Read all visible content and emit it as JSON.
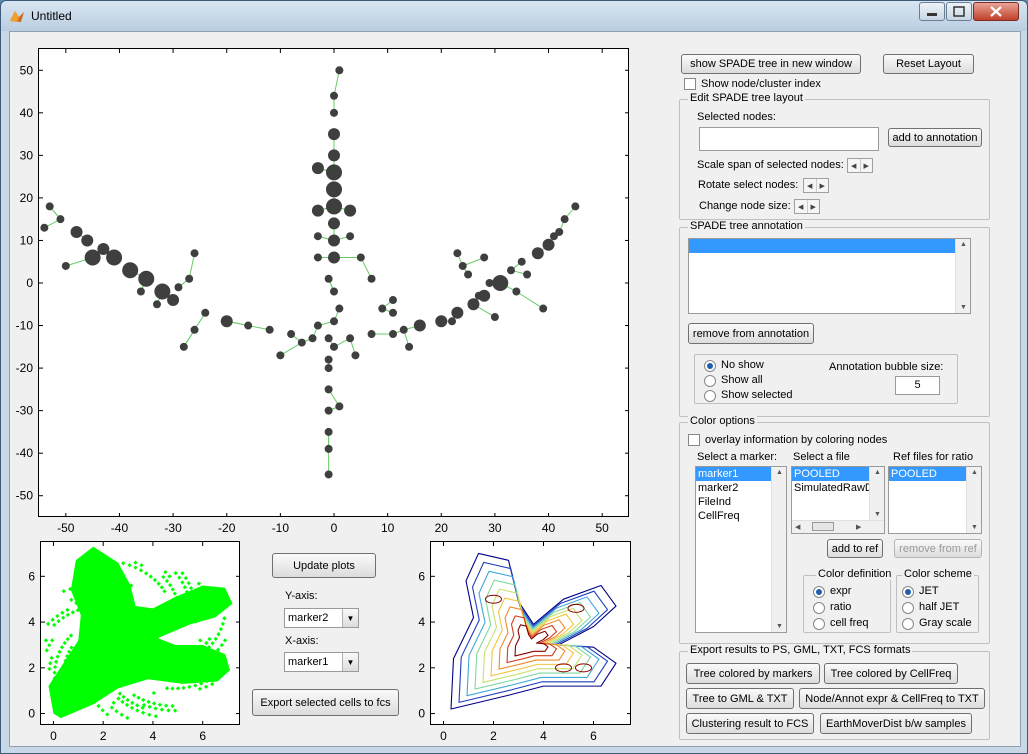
{
  "window": {
    "title": "Untitled"
  },
  "buttons": {
    "show_tree": "show SPADE tree in new window",
    "reset_layout": "Reset Layout",
    "add_annotation": "add to annotation",
    "remove_annotation": "remove from annotation",
    "update_plots": "Update plots",
    "export_cells": "Export selected cells to fcs",
    "add_ref": "add to ref",
    "remove_ref": "remove from ref"
  },
  "options": {
    "show_index": "Show node/cluster index"
  },
  "layout_panel": {
    "title": "Edit SPADE tree layout",
    "selected_nodes_label": "Selected nodes:",
    "selected_nodes_value": "",
    "scale_label": "Scale span of selected nodes:",
    "rotate_label": "Rotate select nodes:",
    "size_label": "Change node size:"
  },
  "annotation_panel": {
    "title": "SPADE tree annotation",
    "radios": [
      "No show",
      "Show all",
      "Show selected"
    ],
    "selected_radio": 0,
    "bubble_label": "Annotation bubble size:",
    "bubble_value": "5"
  },
  "color_panel": {
    "title": "Color options",
    "overlay_label": "overlay information by coloring nodes",
    "marker_label": "Select a marker:",
    "markers": [
      "marker1",
      "marker2",
      "FileInd",
      "CellFreq"
    ],
    "file_label": "Select a file",
    "files": [
      "POOLED",
      "SimulatedRawD"
    ],
    "ref_label": "Ref files for ratio",
    "ref_files": [
      "POOLED"
    ],
    "color_def_title": "Color definition",
    "color_defs": [
      "expr",
      "ratio",
      "cell freq"
    ],
    "color_scheme_title": "Color scheme",
    "color_schemes": [
      "JET",
      "half JET",
      "Gray scale"
    ]
  },
  "export_panel": {
    "title": "Export results to PS, GML, TXT, FCS formats",
    "buttons": [
      "Tree colored by markers",
      "Tree colored by CellFreq",
      "Tree to GML & TXT",
      "Node/Annot expr & CellFreq to TXT",
      "Clustering result to FCS",
      "EarthMoverDist b/w samples"
    ]
  },
  "axes_controls": {
    "y_label": "Y-axis:",
    "y_value": "marker2",
    "x_label": "X-axis:",
    "x_value": "marker1"
  },
  "colors": {
    "node": "#3f3f3f",
    "edge": "#66cc66",
    "scatter": "#00ff00",
    "selection": "#3399ff"
  },
  "chart_data": [
    {
      "type": "scatter",
      "description_role": "spade-tree",
      "xlim": [
        -55,
        55
      ],
      "ylim": [
        -55,
        55
      ],
      "xticks": [
        -50,
        -40,
        -30,
        -20,
        -10,
        0,
        10,
        20,
        30,
        40,
        50
      ],
      "yticks": [
        -50,
        -40,
        -30,
        -20,
        -10,
        0,
        10,
        20,
        30,
        40,
        50
      ],
      "nodes": [
        [
          -53,
          18,
          1
        ],
        [
          -54,
          13,
          1
        ],
        [
          -51,
          15,
          1
        ],
        [
          -48,
          12,
          2
        ],
        [
          -46,
          10,
          2
        ],
        [
          -45,
          6,
          3
        ],
        [
          -50,
          4,
          1
        ],
        [
          -43,
          8,
          2
        ],
        [
          -41,
          6,
          3
        ],
        [
          -38,
          3,
          3
        ],
        [
          -36,
          -2,
          1
        ],
        [
          -35,
          1,
          3
        ],
        [
          -33,
          -5,
          1
        ],
        [
          -32,
          -2,
          3
        ],
        [
          -30,
          -4,
          2
        ],
        [
          -29,
          -1,
          1
        ],
        [
          -27,
          1,
          1
        ],
        [
          -26,
          7,
          1
        ],
        [
          -28,
          -15,
          1
        ],
        [
          -26,
          -11,
          1
        ],
        [
          -24,
          -7,
          1
        ],
        [
          -20,
          -9,
          2
        ],
        [
          -16,
          -10,
          1
        ],
        [
          -12,
          -11,
          1
        ],
        [
          -8,
          -12,
          1
        ],
        [
          -4,
          -13,
          1
        ],
        [
          -1,
          -13,
          1
        ],
        [
          -10,
          -17,
          1
        ],
        [
          -6,
          -14,
          1
        ],
        [
          -3,
          -10,
          1
        ],
        [
          3,
          -13,
          1
        ],
        [
          4,
          -17,
          1
        ],
        [
          7,
          -12,
          1
        ],
        [
          11,
          -12,
          1
        ],
        [
          11,
          -7,
          1
        ],
        [
          13,
          -11,
          1
        ],
        [
          14,
          -15,
          1
        ],
        [
          16,
          -10,
          2
        ],
        [
          20,
          -9,
          2
        ],
        [
          23,
          -7,
          2
        ],
        [
          26,
          -5,
          2
        ],
        [
          28,
          -3,
          2
        ],
        [
          31,
          0,
          3
        ],
        [
          33,
          3,
          1
        ],
        [
          35,
          5,
          1
        ],
        [
          38,
          7,
          2
        ],
        [
          40,
          9,
          2
        ],
        [
          42,
          12,
          1
        ],
        [
          43,
          15,
          1
        ],
        [
          45,
          18,
          1
        ],
        [
          39,
          -6,
          1
        ],
        [
          41,
          11,
          1
        ],
        [
          29,
          0,
          1
        ],
        [
          28,
          6,
          1
        ],
        [
          30,
          -8,
          1
        ],
        [
          25,
          2,
          1
        ],
        [
          24,
          4,
          1
        ],
        [
          23,
          7,
          1
        ],
        [
          27,
          -3,
          1
        ],
        [
          22,
          -9,
          1
        ],
        [
          34,
          -2,
          1
        ],
        [
          36,
          2,
          1
        ],
        [
          9,
          -6,
          1
        ],
        [
          11,
          -4,
          1
        ],
        [
          7,
          1,
          1
        ],
        [
          0,
          -15,
          1
        ],
        [
          -1,
          -20,
          1
        ],
        [
          -1,
          -25,
          1
        ],
        [
          -1,
          -30,
          1
        ],
        [
          -1,
          -35,
          1
        ],
        [
          -1,
          -39,
          1
        ],
        [
          -1,
          -45,
          1
        ],
        [
          1,
          -29,
          1
        ],
        [
          -1,
          -18,
          1
        ],
        [
          0,
          6,
          2
        ],
        [
          0,
          10,
          2
        ],
        [
          0,
          14,
          2
        ],
        [
          0,
          18,
          3
        ],
        [
          0,
          22,
          3
        ],
        [
          0,
          26,
          3
        ],
        [
          0,
          30,
          2
        ],
        [
          0,
          35,
          2
        ],
        [
          0,
          40,
          1
        ],
        [
          0,
          44,
          1
        ],
        [
          1,
          50,
          1
        ],
        [
          -3,
          6,
          1
        ],
        [
          -3,
          11,
          1
        ],
        [
          -3,
          17,
          2
        ],
        [
          -3,
          27,
          2
        ],
        [
          3,
          17,
          2
        ],
        [
          3,
          11,
          1
        ],
        [
          5,
          6,
          1
        ],
        [
          -1,
          1,
          1
        ],
        [
          1,
          -6,
          1
        ],
        [
          0,
          -2,
          1
        ],
        [
          0,
          -9,
          1
        ]
      ]
    },
    {
      "type": "scatter",
      "description_role": "cell-scatter",
      "xlim": [
        -0.5,
        7.5
      ],
      "ylim": [
        -0.5,
        7.5
      ],
      "xticks": [
        0,
        2,
        4,
        6
      ],
      "yticks": [
        0,
        2,
        4,
        6
      ]
    },
    {
      "type": "contour",
      "description_role": "density-contour",
      "xlim": [
        -0.5,
        7.5
      ],
      "ylim": [
        -0.5,
        7.5
      ],
      "xticks": [
        0,
        2,
        4,
        6
      ],
      "yticks": [
        0,
        2,
        4,
        6
      ],
      "levels": 9
    }
  ]
}
